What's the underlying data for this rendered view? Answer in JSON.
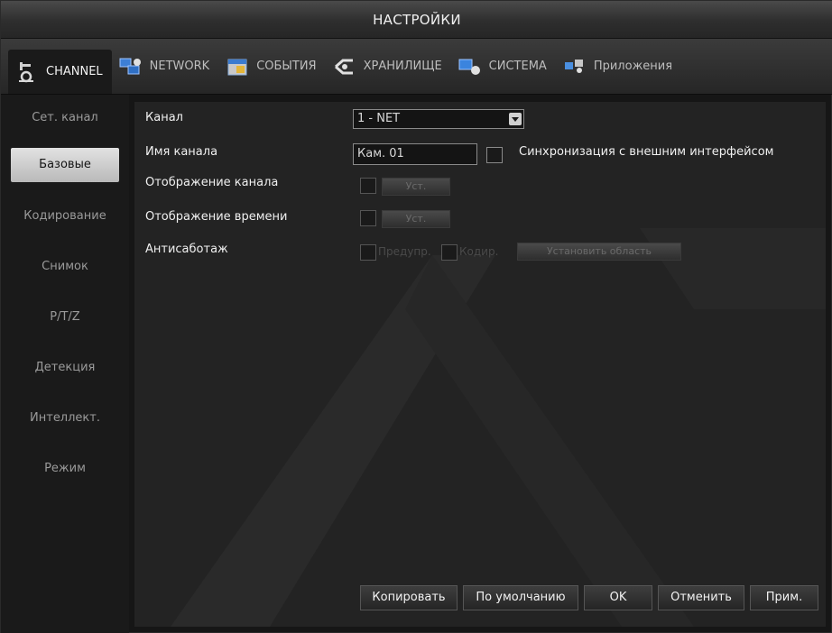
{
  "window": {
    "title": "НАСТРОЙКИ"
  },
  "tabs": [
    {
      "label": "CHANNEL",
      "icon": "camera-icon",
      "active": true
    },
    {
      "label": "NETWORK",
      "icon": "network-icon",
      "active": false
    },
    {
      "label": "СОБЫТИЯ",
      "icon": "calendar-icon",
      "active": false
    },
    {
      "label": "ХРАНИЛИЩЕ",
      "icon": "storage-icon",
      "active": false
    },
    {
      "label": "СИСТЕМА",
      "icon": "system-icon",
      "active": false
    },
    {
      "label": "Приложения",
      "icon": "apps-icon",
      "active": false
    }
  ],
  "sidebar": {
    "items": [
      {
        "label": "Сет. канал",
        "active": false
      },
      {
        "label": "Базовые",
        "active": true
      },
      {
        "label": "Кодирование",
        "active": false
      },
      {
        "label": "Снимок",
        "active": false
      },
      {
        "label": "P/T/Z",
        "active": false
      },
      {
        "label": "Детекция",
        "active": false
      },
      {
        "label": "Интеллект.",
        "active": false
      },
      {
        "label": "Режим",
        "active": false
      }
    ]
  },
  "form": {
    "channel": {
      "label": "Канал",
      "value": "1 - NET"
    },
    "channel_name": {
      "label": "Имя канала",
      "value": "Кам. 01"
    },
    "sync": {
      "label": "Синхронизация с внешним интерфейсом"
    },
    "show_channel": {
      "label": "Отображение канала",
      "button": "Уст."
    },
    "show_time": {
      "label": "Отображение времени",
      "button": "Уст."
    },
    "antisabotage": {
      "label": "Антисаботаж",
      "warn_label": "Предупр.",
      "code_label": "Кодир.",
      "button": "Установить область"
    }
  },
  "footer": {
    "copy": "Копировать",
    "default": "По умолчанию",
    "ok": "OK",
    "cancel": "Отменить",
    "apply": "Прим."
  },
  "colors": {
    "background": "#161616",
    "panel": "#232323",
    "sidebar_active": "#c8c8c8",
    "text": "#f0f0f0",
    "muted": "#9a9a9a"
  }
}
